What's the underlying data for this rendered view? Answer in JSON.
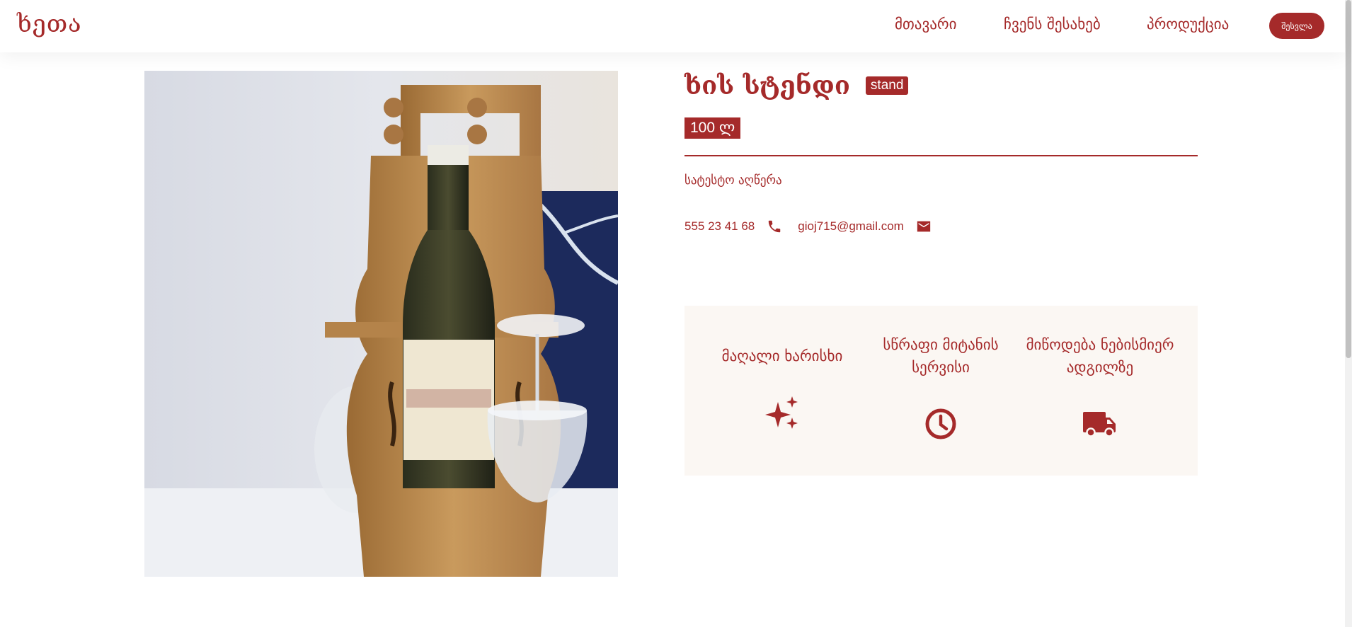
{
  "header": {
    "logo": "ხეთა",
    "nav": {
      "home": "მთავარი",
      "about": "ჩვენს შესახებ",
      "products": "პროდუქცია"
    },
    "login_label": "შესვლა"
  },
  "product": {
    "image_alt": "violin-shaped wooden wine bottle and glass holder",
    "title": "ხის სტენდი",
    "category": "stand",
    "price": "100 ლ",
    "description": "სატესტო აღწერა",
    "phone": "555 23 41 68",
    "email": "gioj715@gmail.com"
  },
  "features": {
    "quality": "მაღალი ხარისხი",
    "fast_delivery_line1": "სწრაფი მიტანის",
    "fast_delivery_line2": "სერვისი",
    "anywhere_line1": "მიწოდება ნებისმიერ",
    "anywhere_line2": "ადგილზე"
  },
  "icons": {
    "phone": "phone-icon",
    "mail": "mail-icon",
    "quality": "sparkles-icon",
    "speed": "clock-icon",
    "delivery": "truck-icon"
  },
  "colors": {
    "accent": "#a52a2a",
    "feature_bg": "#fbf7f3",
    "header_bg": "#ffffff"
  }
}
